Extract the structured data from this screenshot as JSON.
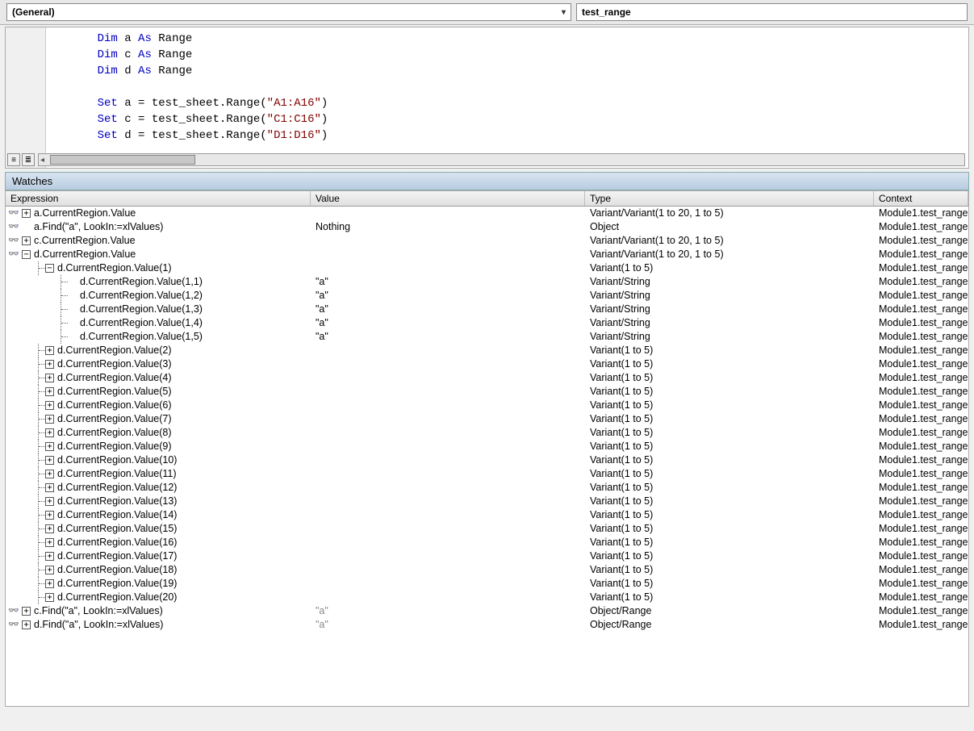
{
  "dropdowns": {
    "object": "(General)",
    "procedure": "test_range"
  },
  "code": {
    "lines": [
      {
        "indent": 1,
        "tokens": [
          {
            "t": "Dim",
            "c": "kw"
          },
          {
            "t": " a "
          },
          {
            "t": "As",
            "c": "kw"
          },
          {
            "t": " Range"
          }
        ]
      },
      {
        "indent": 1,
        "tokens": [
          {
            "t": "Dim",
            "c": "kw"
          },
          {
            "t": " c "
          },
          {
            "t": "As",
            "c": "kw"
          },
          {
            "t": " Range"
          }
        ]
      },
      {
        "indent": 1,
        "tokens": [
          {
            "t": "Dim",
            "c": "kw"
          },
          {
            "t": " d "
          },
          {
            "t": "As",
            "c": "kw"
          },
          {
            "t": " Range"
          }
        ]
      },
      {
        "indent": 1,
        "tokens": []
      },
      {
        "indent": 1,
        "tokens": [
          {
            "t": "Set",
            "c": "kw"
          },
          {
            "t": " a = test_sheet.Range("
          },
          {
            "t": "\"A1:A16\"",
            "c": "str"
          },
          {
            "t": ")"
          }
        ]
      },
      {
        "indent": 1,
        "tokens": [
          {
            "t": "Set",
            "c": "kw"
          },
          {
            "t": " c = test_sheet.Range("
          },
          {
            "t": "\"C1:C16\"",
            "c": "str"
          },
          {
            "t": ")"
          }
        ]
      },
      {
        "indent": 1,
        "tokens": [
          {
            "t": "Set",
            "c": "kw"
          },
          {
            "t": " d = test_sheet.Range("
          },
          {
            "t": "\"D1:D16\"",
            "c": "str"
          },
          {
            "t": ")"
          }
        ]
      }
    ]
  },
  "watches": {
    "title": "Watches",
    "headers": {
      "expression": "Expression",
      "value": "Value",
      "type": "Type",
      "context": "Context"
    },
    "glyph": "👓",
    "rows": [
      {
        "depth": 0,
        "icon": true,
        "toggle": "plus",
        "expr": "a.CurrentRegion.Value",
        "val": "",
        "type": "Variant/Variant(1 to 20, 1 to 5)",
        "ctx": "Module1.test_range"
      },
      {
        "depth": 0,
        "icon": true,
        "toggle": "",
        "expr": "a.Find(\"a\", LookIn:=xlValues)",
        "val": "Nothing",
        "type": "Object",
        "ctx": "Module1.test_range"
      },
      {
        "depth": 0,
        "icon": true,
        "toggle": "plus",
        "expr": "c.CurrentRegion.Value",
        "val": "",
        "type": "Variant/Variant(1 to 20, 1 to 5)",
        "ctx": "Module1.test_range"
      },
      {
        "depth": 0,
        "icon": true,
        "toggle": "minus",
        "expr": "d.CurrentRegion.Value",
        "val": "",
        "type": "Variant/Variant(1 to 20, 1 to 5)",
        "ctx": "Module1.test_range"
      },
      {
        "depth": 1,
        "icon": false,
        "toggle": "minus",
        "expr": "d.CurrentRegion.Value(1)",
        "val": "",
        "type": "Variant(1 to 5)",
        "ctx": "Module1.test_range"
      },
      {
        "depth": 2,
        "icon": false,
        "toggle": "",
        "expr": "d.CurrentRegion.Value(1,1)",
        "val": "\"a\"",
        "type": "Variant/String",
        "ctx": "Module1.test_range"
      },
      {
        "depth": 2,
        "icon": false,
        "toggle": "",
        "expr": "d.CurrentRegion.Value(1,2)",
        "val": "\"a\"",
        "type": "Variant/String",
        "ctx": "Module1.test_range"
      },
      {
        "depth": 2,
        "icon": false,
        "toggle": "",
        "expr": "d.CurrentRegion.Value(1,3)",
        "val": "\"a\"",
        "type": "Variant/String",
        "ctx": "Module1.test_range"
      },
      {
        "depth": 2,
        "icon": false,
        "toggle": "",
        "expr": "d.CurrentRegion.Value(1,4)",
        "val": "\"a\"",
        "type": "Variant/String",
        "ctx": "Module1.test_range"
      },
      {
        "depth": 2,
        "icon": false,
        "toggle": "",
        "last": true,
        "expr": "d.CurrentRegion.Value(1,5)",
        "val": "\"a\"",
        "type": "Variant/String",
        "ctx": "Module1.test_range"
      },
      {
        "depth": 1,
        "icon": false,
        "toggle": "plus",
        "expr": "d.CurrentRegion.Value(2)",
        "val": "",
        "type": "Variant(1 to 5)",
        "ctx": "Module1.test_range"
      },
      {
        "depth": 1,
        "icon": false,
        "toggle": "plus",
        "expr": "d.CurrentRegion.Value(3)",
        "val": "",
        "type": "Variant(1 to 5)",
        "ctx": "Module1.test_range"
      },
      {
        "depth": 1,
        "icon": false,
        "toggle": "plus",
        "expr": "d.CurrentRegion.Value(4)",
        "val": "",
        "type": "Variant(1 to 5)",
        "ctx": "Module1.test_range"
      },
      {
        "depth": 1,
        "icon": false,
        "toggle": "plus",
        "expr": "d.CurrentRegion.Value(5)",
        "val": "",
        "type": "Variant(1 to 5)",
        "ctx": "Module1.test_range"
      },
      {
        "depth": 1,
        "icon": false,
        "toggle": "plus",
        "expr": "d.CurrentRegion.Value(6)",
        "val": "",
        "type": "Variant(1 to 5)",
        "ctx": "Module1.test_range"
      },
      {
        "depth": 1,
        "icon": false,
        "toggle": "plus",
        "expr": "d.CurrentRegion.Value(7)",
        "val": "",
        "type": "Variant(1 to 5)",
        "ctx": "Module1.test_range"
      },
      {
        "depth": 1,
        "icon": false,
        "toggle": "plus",
        "expr": "d.CurrentRegion.Value(8)",
        "val": "",
        "type": "Variant(1 to 5)",
        "ctx": "Module1.test_range"
      },
      {
        "depth": 1,
        "icon": false,
        "toggle": "plus",
        "expr": "d.CurrentRegion.Value(9)",
        "val": "",
        "type": "Variant(1 to 5)",
        "ctx": "Module1.test_range"
      },
      {
        "depth": 1,
        "icon": false,
        "toggle": "plus",
        "expr": "d.CurrentRegion.Value(10)",
        "val": "",
        "type": "Variant(1 to 5)",
        "ctx": "Module1.test_range"
      },
      {
        "depth": 1,
        "icon": false,
        "toggle": "plus",
        "expr": "d.CurrentRegion.Value(11)",
        "val": "",
        "type": "Variant(1 to 5)",
        "ctx": "Module1.test_range"
      },
      {
        "depth": 1,
        "icon": false,
        "toggle": "plus",
        "expr": "d.CurrentRegion.Value(12)",
        "val": "",
        "type": "Variant(1 to 5)",
        "ctx": "Module1.test_range"
      },
      {
        "depth": 1,
        "icon": false,
        "toggle": "plus",
        "expr": "d.CurrentRegion.Value(13)",
        "val": "",
        "type": "Variant(1 to 5)",
        "ctx": "Module1.test_range"
      },
      {
        "depth": 1,
        "icon": false,
        "toggle": "plus",
        "expr": "d.CurrentRegion.Value(14)",
        "val": "",
        "type": "Variant(1 to 5)",
        "ctx": "Module1.test_range"
      },
      {
        "depth": 1,
        "icon": false,
        "toggle": "plus",
        "expr": "d.CurrentRegion.Value(15)",
        "val": "",
        "type": "Variant(1 to 5)",
        "ctx": "Module1.test_range"
      },
      {
        "depth": 1,
        "icon": false,
        "toggle": "plus",
        "expr": "d.CurrentRegion.Value(16)",
        "val": "",
        "type": "Variant(1 to 5)",
        "ctx": "Module1.test_range"
      },
      {
        "depth": 1,
        "icon": false,
        "toggle": "plus",
        "expr": "d.CurrentRegion.Value(17)",
        "val": "",
        "type": "Variant(1 to 5)",
        "ctx": "Module1.test_range"
      },
      {
        "depth": 1,
        "icon": false,
        "toggle": "plus",
        "expr": "d.CurrentRegion.Value(18)",
        "val": "",
        "type": "Variant(1 to 5)",
        "ctx": "Module1.test_range"
      },
      {
        "depth": 1,
        "icon": false,
        "toggle": "plus",
        "expr": "d.CurrentRegion.Value(19)",
        "val": "",
        "type": "Variant(1 to 5)",
        "ctx": "Module1.test_range"
      },
      {
        "depth": 1,
        "icon": false,
        "toggle": "plus",
        "last": true,
        "expr": "d.CurrentRegion.Value(20)",
        "val": "",
        "type": "Variant(1 to 5)",
        "ctx": "Module1.test_range"
      },
      {
        "depth": 0,
        "icon": true,
        "toggle": "plus",
        "dim": true,
        "expr": "c.Find(\"a\", LookIn:=xlValues)",
        "val": "\"a\"",
        "type": "Object/Range",
        "ctx": "Module1.test_range"
      },
      {
        "depth": 0,
        "icon": true,
        "toggle": "plus",
        "dim": true,
        "expr": "d.Find(\"a\", LookIn:=xlValues)",
        "val": "\"a\"",
        "type": "Object/Range",
        "ctx": "Module1.test_range"
      }
    ]
  }
}
